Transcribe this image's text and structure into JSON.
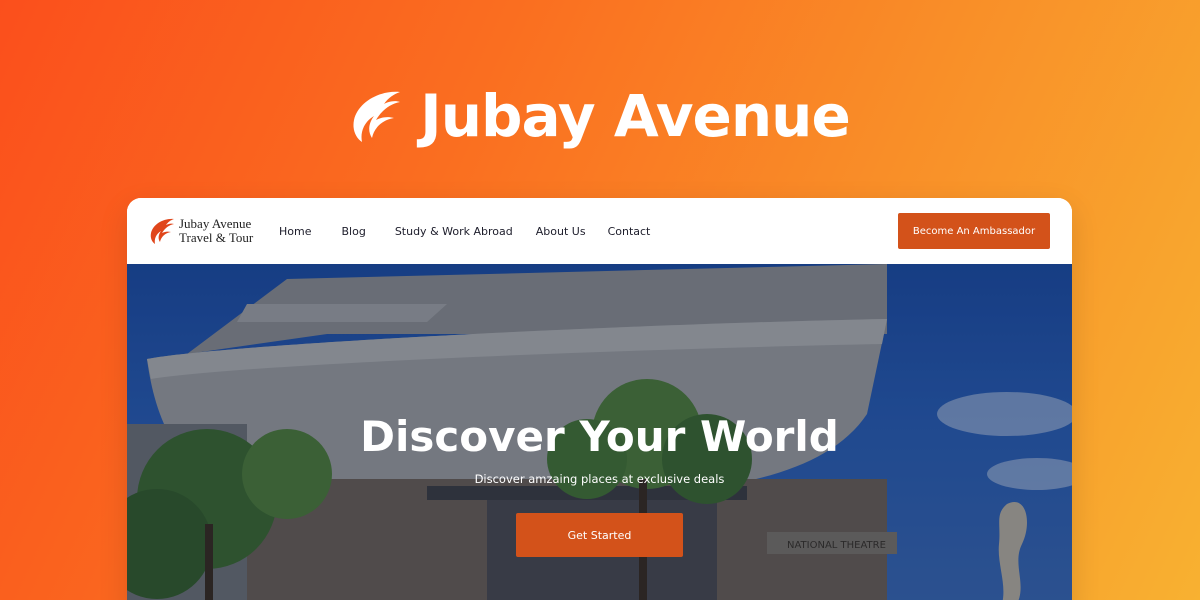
{
  "brand": {
    "icon": "feather-logo-icon",
    "title": "Jubay Avenue"
  },
  "site": {
    "logo_icon": "feather-logo-icon",
    "logo_line1": "Jubay Avenue",
    "logo_line2": "Travel & Tour",
    "nav": {
      "home": "Home",
      "blog": "Blog",
      "study": "Study & Work Abroad",
      "about": "About Us",
      "contact": "Contact"
    },
    "cta_label": "Become An Ambassador"
  },
  "hero": {
    "title": "Discover Your World",
    "subtitle": "Discover amzaing places at exclusive deals",
    "button_label": "Get Started",
    "building_sign": "NATIONAL THEATRE"
  },
  "colors": {
    "accent": "#d3521a",
    "gradient_start": "#fb4f1c",
    "gradient_end": "#f8b131"
  }
}
